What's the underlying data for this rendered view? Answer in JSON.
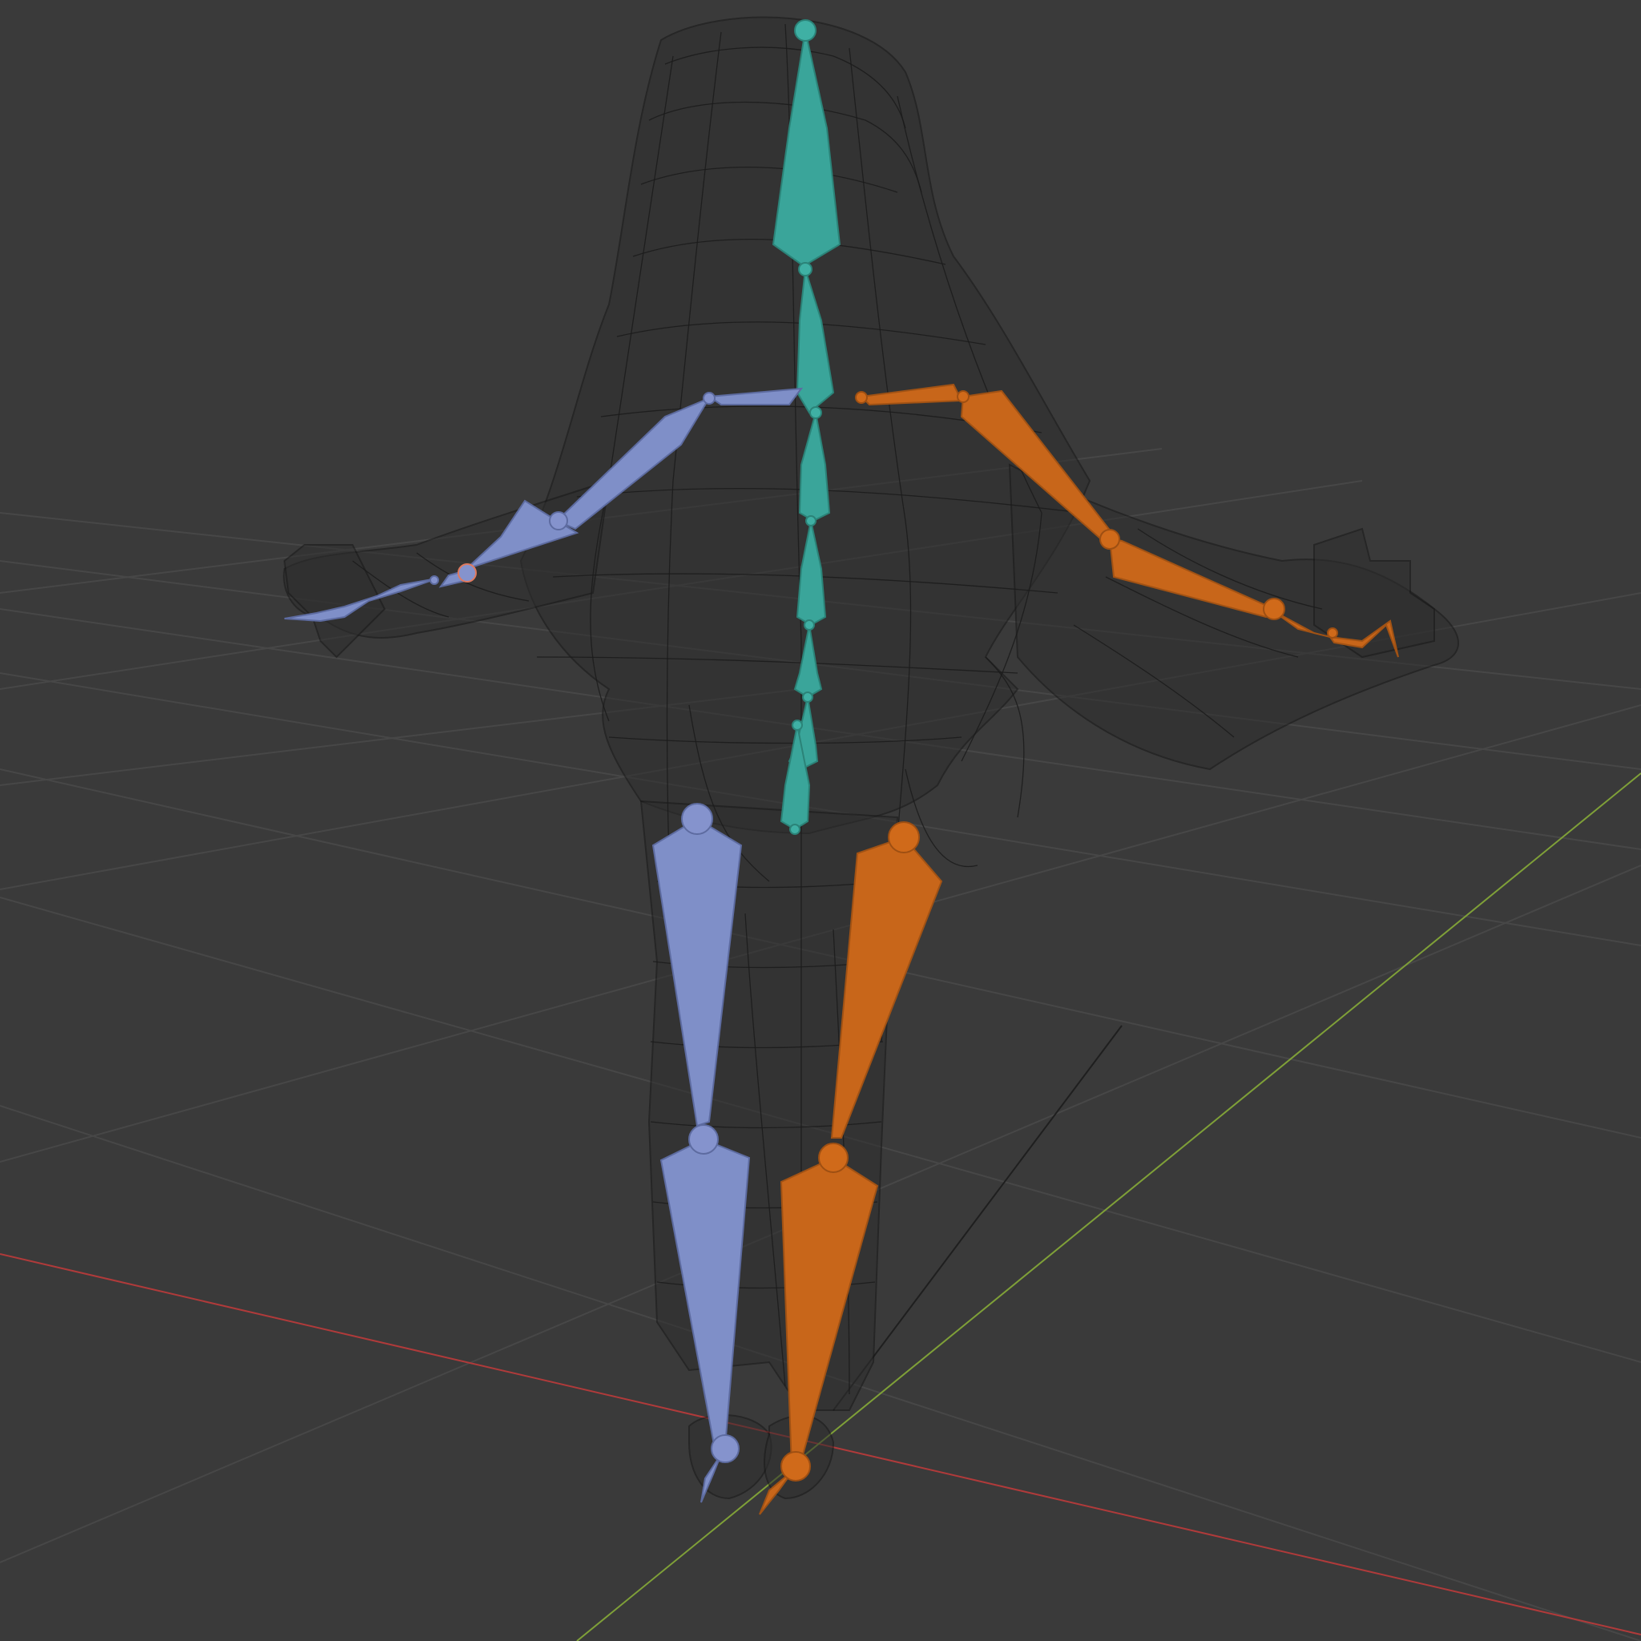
{
  "viewport": {
    "mode": "wireframe",
    "background_color": "#393939",
    "grid_color": "#4a4a4a",
    "x_axis_color": "#b03a3a",
    "y_axis_color": "#7fa038",
    "wireframe_color": "#1b1b1b"
  },
  "armature": {
    "bone_groups": [
      {
        "name": "left_side",
        "color": "#7f8fc8"
      },
      {
        "name": "right_side",
        "color": "#c8661a"
      },
      {
        "name": "spine",
        "color": "#3aa59a"
      }
    ]
  },
  "icons": {
    "grid": "floor-grid-icon",
    "mesh": "wireframe-mesh-icon",
    "armature": "armature-bones-icon"
  }
}
